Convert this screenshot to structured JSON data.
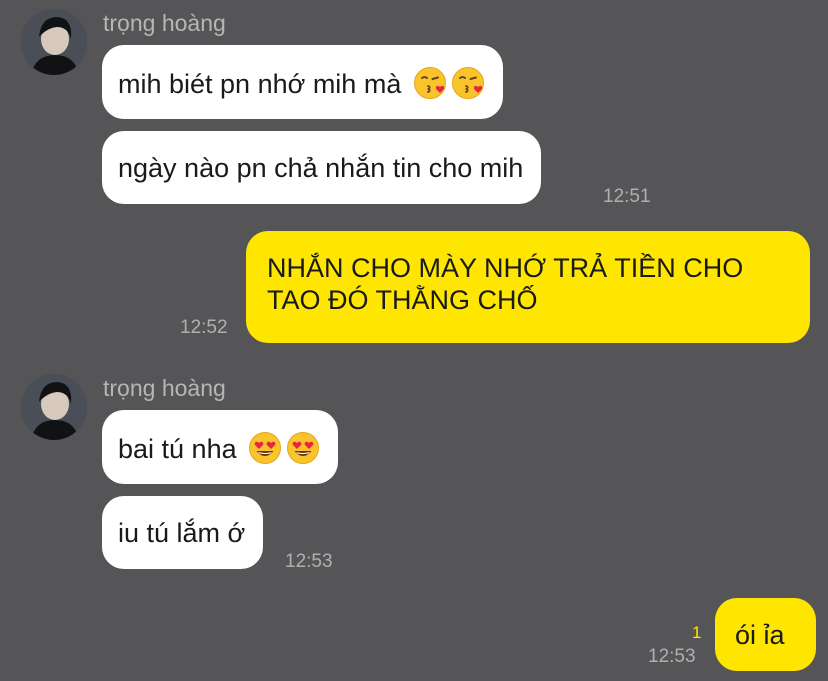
{
  "messages": [
    {
      "type": "received",
      "sender": "trọng hoàng",
      "text": "mih biét pn nhớ mih mà",
      "emoji": [
        "kissing-heart-emoji",
        "kissing-heart-emoji"
      ]
    },
    {
      "type": "received",
      "text": "ngày nào pn chả nhắn tin cho mih",
      "time": "12:51"
    },
    {
      "type": "sent",
      "text": "NHẮN CHO MÀY NHỚ TRẢ TIỀN CHO TAO ĐÓ THẰNG CHỐ",
      "time": "12:52"
    },
    {
      "type": "received",
      "sender": "trọng hoàng",
      "text": "bai tú nha",
      "emoji": [
        "heart-eyes-emoji",
        "heart-eyes-emoji"
      ]
    },
    {
      "type": "received",
      "text": "iu tú lắm ớ",
      "time": "12:53"
    },
    {
      "type": "sent",
      "text": "ói ỉa",
      "time": "12:53",
      "unread_count": "1"
    }
  ],
  "colors": {
    "background": "#555456",
    "received_bubble": "#ffffff",
    "sent_bubble": "#ffe600",
    "timestamp": "#b0b0b0",
    "sender_name": "#b6b6b6",
    "unread": "#ffe600"
  }
}
